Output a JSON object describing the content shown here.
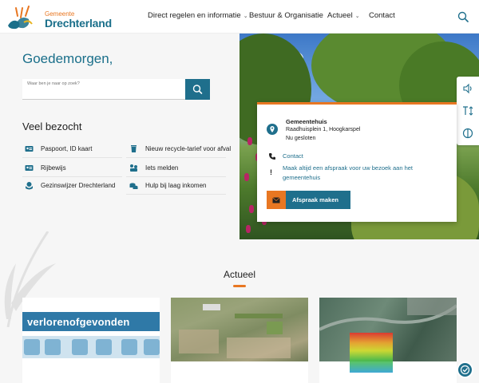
{
  "header": {
    "logo_small": "Gemeente",
    "logo_big": "Drechterland",
    "nav": [
      {
        "label": "Direct regelen en informatie",
        "has_dropdown": true
      },
      {
        "label": "Bestuur & Organisatie",
        "has_dropdown": false
      },
      {
        "label": "Actueel",
        "has_dropdown": true
      },
      {
        "label": "Contact",
        "has_dropdown": false
      }
    ],
    "chevron": "⌄"
  },
  "home": {
    "greeting": "Goedemorgen,",
    "search_placeholder": "Waar ben je naar op zoek?"
  },
  "veel_bezocht": {
    "title": "Veel bezocht",
    "items": [
      {
        "label": "Paspoort, ID kaart",
        "icon": "id-card-icon"
      },
      {
        "label": "Nieuw recycle-tarief voor afval",
        "icon": "trash-icon"
      },
      {
        "label": "Rijbewijs",
        "icon": "id-card-icon"
      },
      {
        "label": "Iets melden",
        "icon": "report-icon"
      },
      {
        "label": "Gezinswijzer Drechterland",
        "icon": "family-icon"
      },
      {
        "label": "Hulp bij laag inkomen",
        "icon": "coins-icon"
      }
    ]
  },
  "info_card": {
    "title": "Gemeentehuis",
    "address": "Raadhuisplein 1, Hoogkarspel",
    "status": "Nu gesloten",
    "contact_label": "Contact",
    "appointment_text_1": "Maak altijd een afspraak voor uw bezoek aan het",
    "appointment_text_2": "gemeentehuis",
    "button_label": "Afspraak maken",
    "accent": "#e87722",
    "primary": "#1f6f8c"
  },
  "actueel": {
    "title": "Actueel",
    "cards": [
      {
        "kind": "brand-banner",
        "brand_text": "verlorenofgevonden"
      },
      {
        "kind": "aerial-photo"
      },
      {
        "kind": "aerial-heatmap"
      }
    ]
  }
}
